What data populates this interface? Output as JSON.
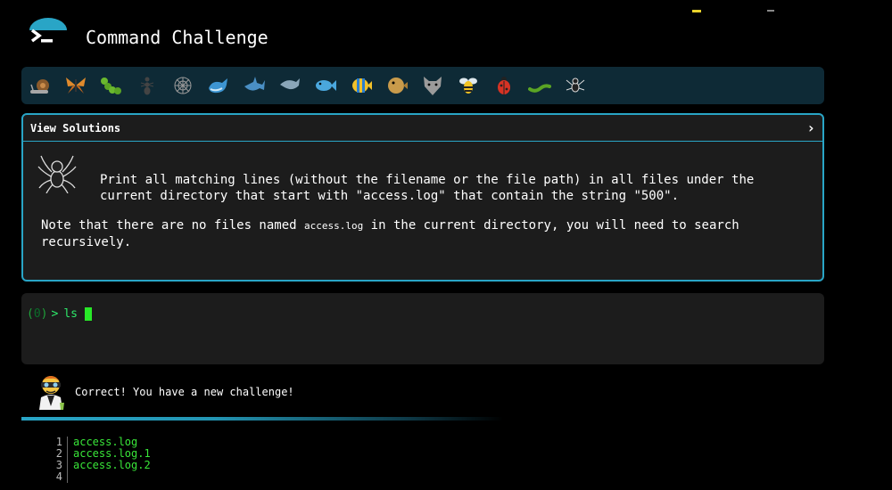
{
  "header": {
    "title": "Command Challenge"
  },
  "level_bar": {
    "icons": [
      "snail-icon",
      "butterfly-icon",
      "caterpillar-icon",
      "ant-icon",
      "spiderweb-icon",
      "whale-icon",
      "shark-icon",
      "dolphin-icon",
      "fish-icon",
      "tropical-fish-icon",
      "blowfish-icon",
      "wolf-icon",
      "bee-icon",
      "ladybug-icon",
      "worm-icon",
      "spider-icon"
    ]
  },
  "challenge": {
    "view_solutions_label": "View Solutions",
    "chevron": "›",
    "text": "Print all matching lines (without the filename or the file path) in all files under the current directory that start with \"access.log\" that contain the string \"500\".",
    "note_before": "Note that there are no files named ",
    "note_code": "access.log",
    "note_after": " in the current directory, you will need to search recursively."
  },
  "terminal": {
    "prompt_open": "(",
    "prompt_status": "0",
    "prompt_close": ")",
    "prompt_arrow": ">",
    "input": "ls"
  },
  "status": {
    "message": "Correct! You have a new challenge!"
  },
  "output": {
    "lines": [
      {
        "no": "1",
        "text": "access.log"
      },
      {
        "no": "2",
        "text": "access.log.1"
      },
      {
        "no": "3",
        "text": "access.log.2"
      },
      {
        "no": "4",
        "text": ""
      }
    ]
  },
  "colors": {
    "accent": "#29a5c6",
    "prompt_green": "#2ee86a",
    "panel_bg": "#1c1c1c",
    "bar_bg": "#0e2a36"
  }
}
